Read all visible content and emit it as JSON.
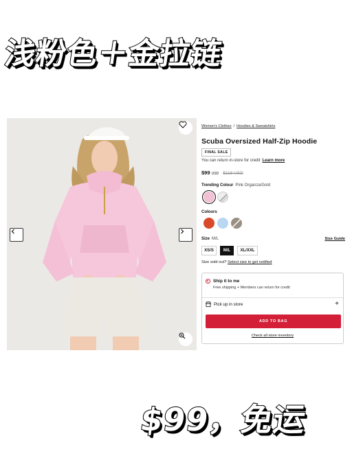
{
  "captions": {
    "top": "浅粉色＋金拉链",
    "bottom": "$99，免运"
  },
  "breadcrumb": {
    "items": [
      "Women's Clothes",
      "Hoodies & Sweatshirts"
    ],
    "separator": "/"
  },
  "product": {
    "title": "Scuba Oversized Half-Zip Hoodie",
    "badge": "FINAL SALE",
    "return_note": "You can return in-store for credit",
    "return_link": "Learn more",
    "price": "$99",
    "currency": "USD",
    "original_price": "$118 USD"
  },
  "trending": {
    "label": "Trending Colour",
    "value": "Pink Organza/Gold",
    "swatches": [
      {
        "name": "Pink Organza/Gold",
        "color": "#f2c2d4",
        "selected": true
      },
      {
        "name": "pattern",
        "color": "#e8e8e8",
        "selected": false
      }
    ]
  },
  "colours": {
    "label": "Colours",
    "swatches": [
      {
        "color": "#d94a2a"
      },
      {
        "color": "#b9d6f2"
      },
      {
        "color": "#9a8f84"
      }
    ]
  },
  "size": {
    "label": "Size",
    "value": "M/L",
    "guide": "Size Guide",
    "options": [
      "XS/S",
      "M/L",
      "XL/XXL"
    ],
    "selected": "M/L",
    "soldout_text": "Size sold out?",
    "soldout_link": "Select size to get notified"
  },
  "fulfilment": {
    "ship_title": "Ship it to me",
    "ship_sub": "Free shipping + Members can return for credit",
    "pickup": "Pick up in store",
    "add_to_bag": "ADD TO BAG",
    "inventory": "Check all store inventory"
  },
  "colors": {
    "accent": "#d31f38",
    "hoodie": "#f6c6da",
    "shorts": "#ece9e3"
  },
  "icons": {
    "favorite": "heart-icon",
    "prev": "chevron-left-icon",
    "next": "chevron-right-icon",
    "zoom": "zoom-icon",
    "store": "store-icon",
    "expand": "plus-icon"
  }
}
